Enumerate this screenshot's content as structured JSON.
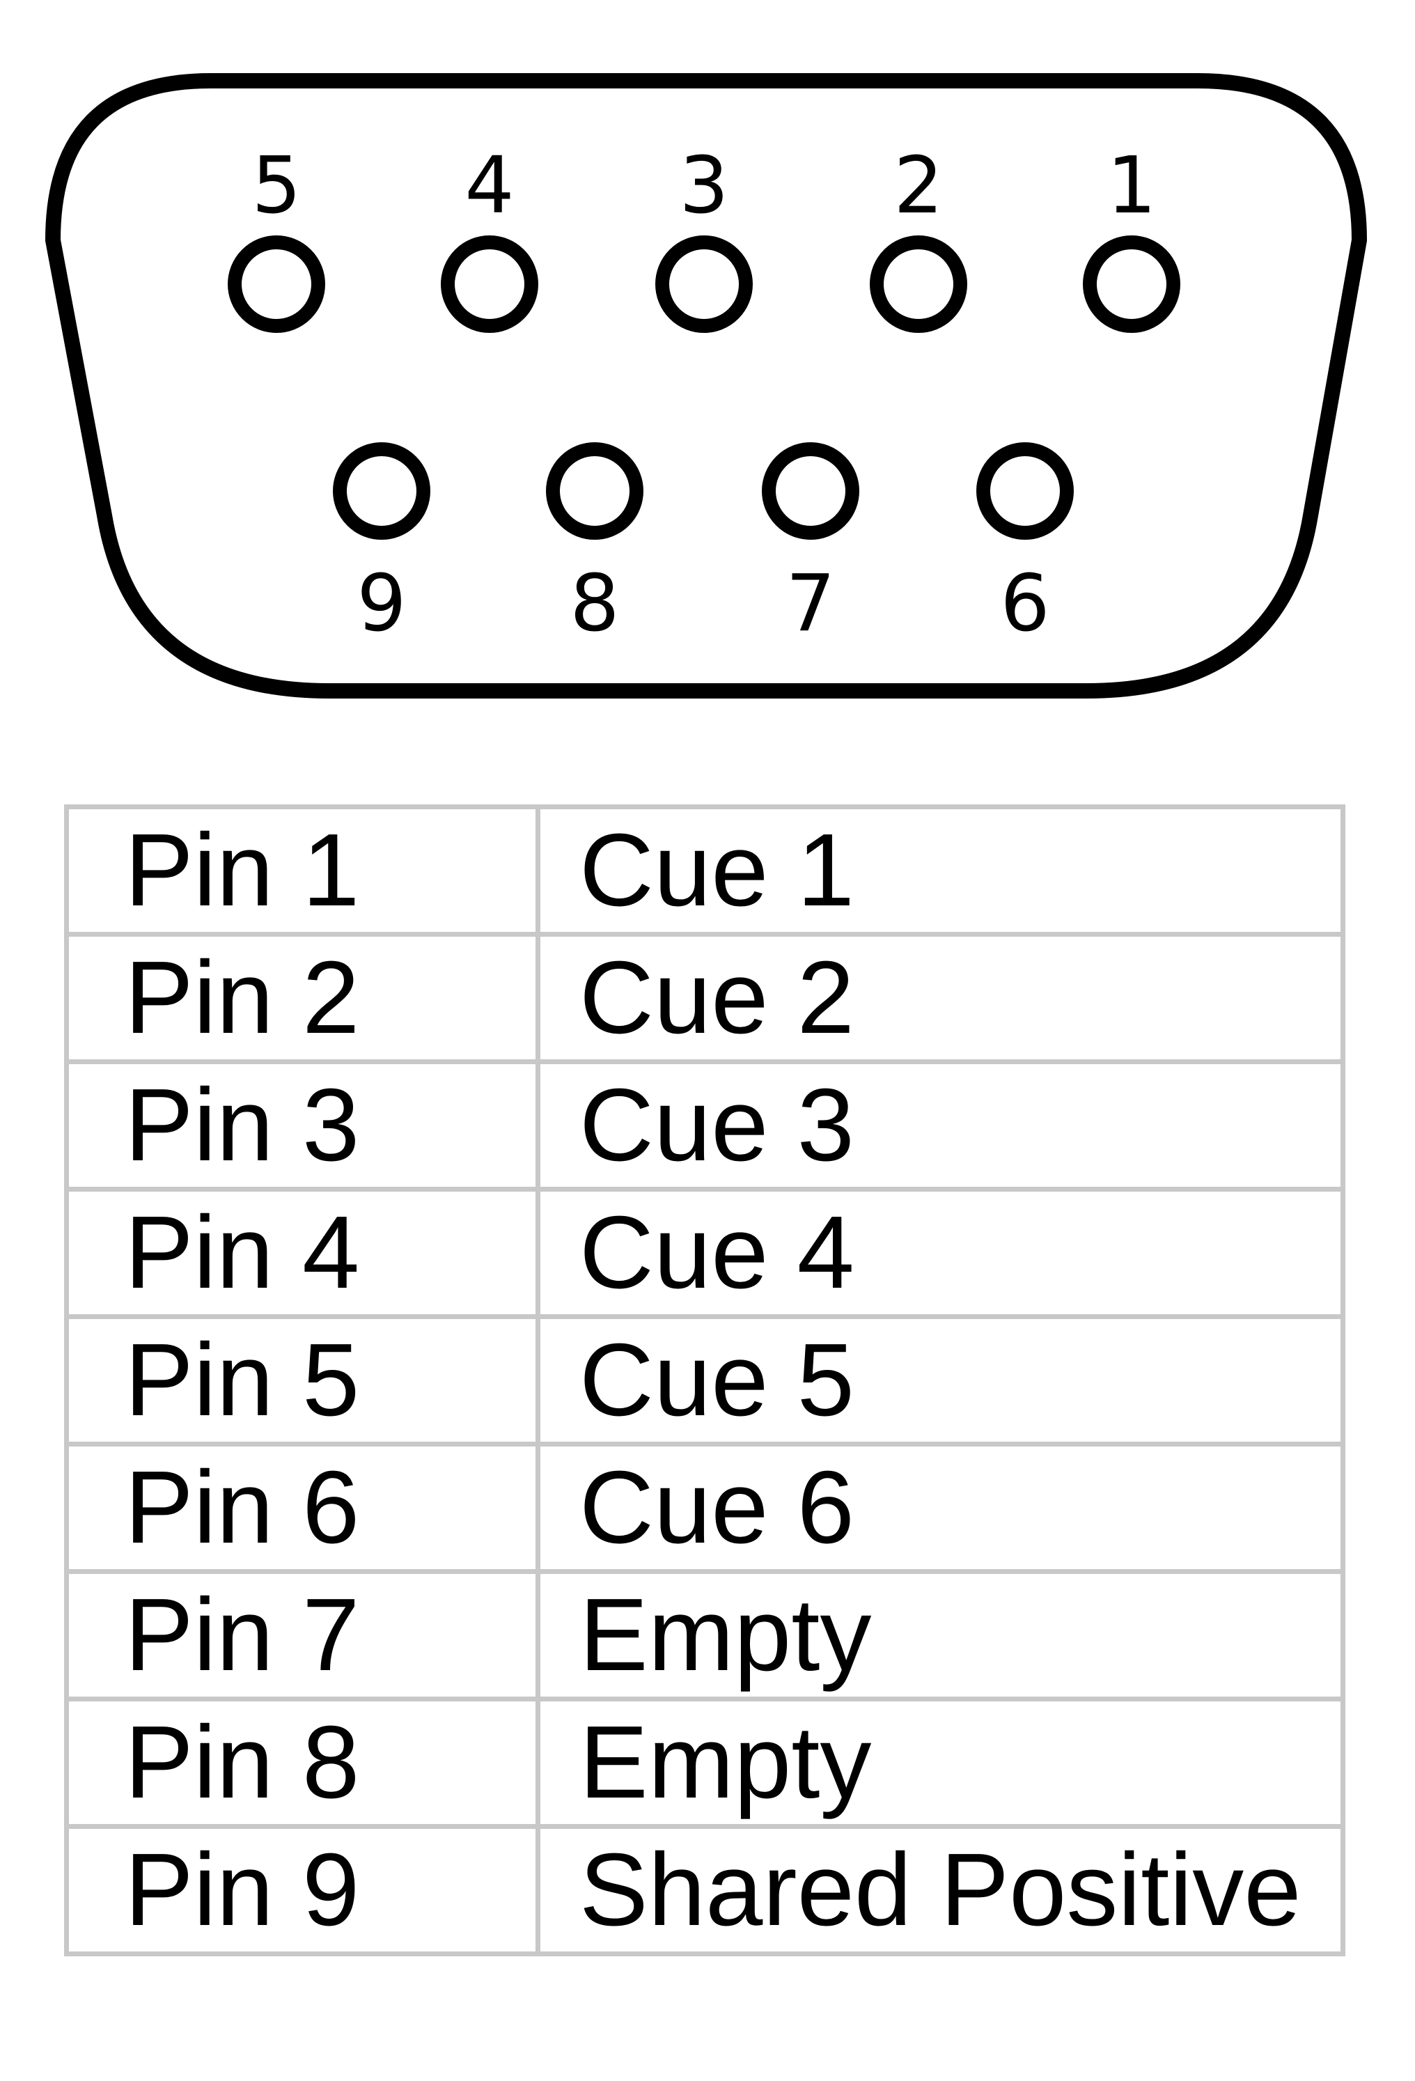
{
  "connector": {
    "top_row_labels": [
      "5",
      "4",
      "3",
      "2",
      "1"
    ],
    "bottom_row_labels": [
      "9",
      "8",
      "7",
      "6"
    ]
  },
  "table": {
    "rows": [
      {
        "pin": "Pin 1",
        "function": "Cue 1"
      },
      {
        "pin": "Pin 2",
        "function": "Cue 2"
      },
      {
        "pin": "Pin 3",
        "function": "Cue 3"
      },
      {
        "pin": "Pin 4",
        "function": "Cue 4"
      },
      {
        "pin": "Pin 5",
        "function": "Cue 5"
      },
      {
        "pin": "Pin 6",
        "function": "Cue 6"
      },
      {
        "pin": "Pin 7",
        "function": "Empty"
      },
      {
        "pin": "Pin 8",
        "function": "Empty"
      },
      {
        "pin": "Pin 9",
        "function": "Shared Positive"
      }
    ]
  }
}
